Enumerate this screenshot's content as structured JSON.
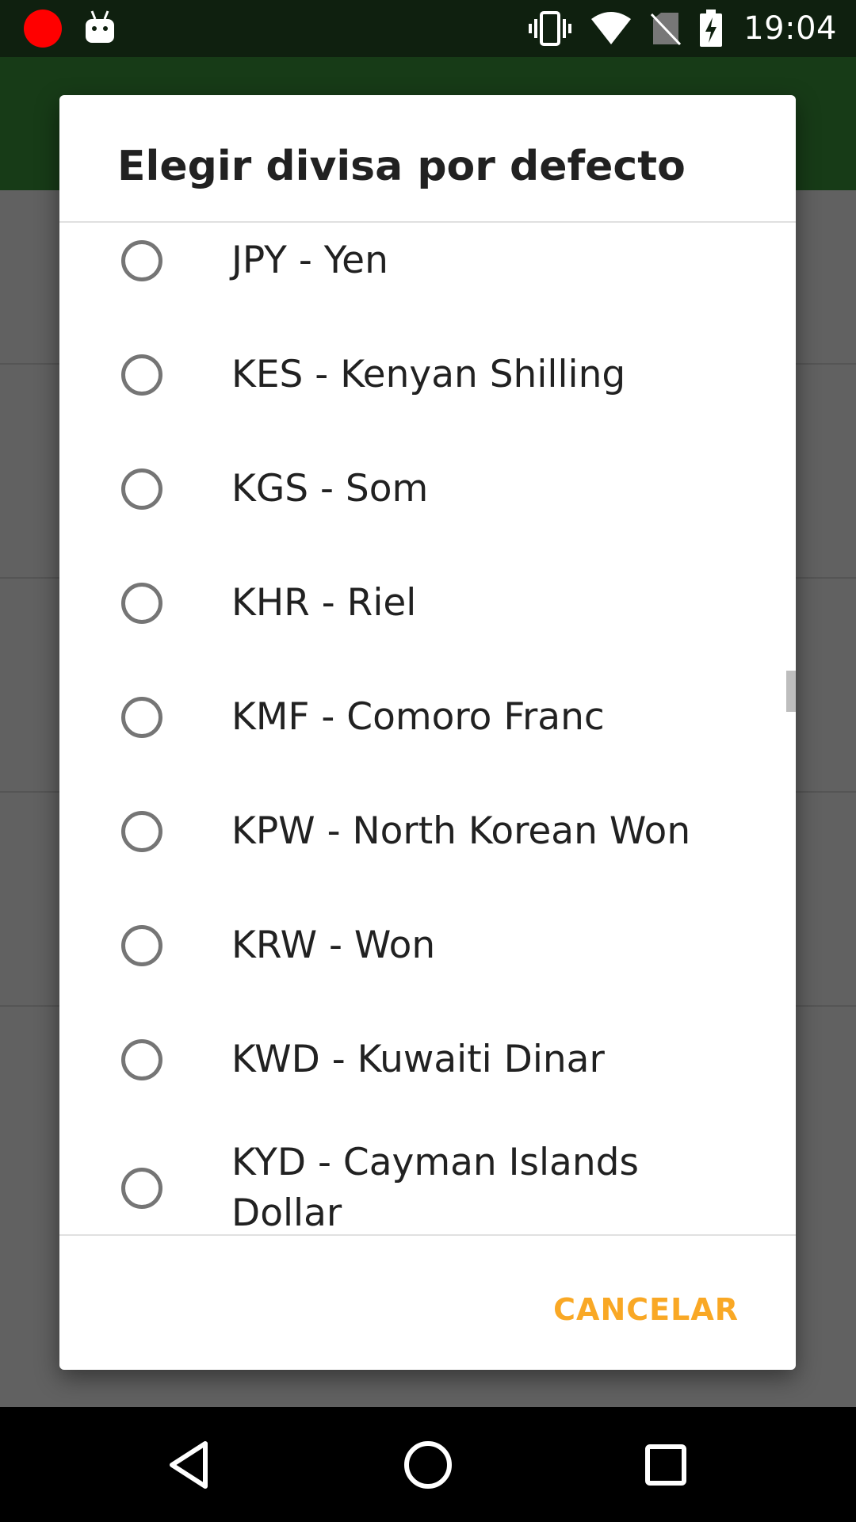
{
  "status_bar": {
    "time": "19:04",
    "icons": [
      "record-icon",
      "android-icon",
      "vibrate-icon",
      "wifi-icon",
      "no-sim-icon",
      "battery-charging-icon"
    ]
  },
  "dialog": {
    "title": "Elegir divisa por defecto",
    "options": [
      {
        "label": "JPY - Yen",
        "selected": false
      },
      {
        "label": "KES - Kenyan Shilling",
        "selected": false
      },
      {
        "label": "KGS - Som",
        "selected": false
      },
      {
        "label": "KHR - Riel",
        "selected": false
      },
      {
        "label": "KMF - Comoro Franc",
        "selected": false
      },
      {
        "label": "KPW - North Korean Won",
        "selected": false
      },
      {
        "label": "KRW - Won",
        "selected": false
      },
      {
        "label": "KWD - Kuwaiti Dinar",
        "selected": false
      },
      {
        "label": "KYD - Cayman Islands Dollar",
        "selected": false
      }
    ],
    "cancel_label": "CANCELAR"
  },
  "colors": {
    "status_bar": "#0f200f",
    "app_bar": "#173b17",
    "scrim": "#616161",
    "accent": "#f9a825",
    "radio": "#757575"
  },
  "nav_bar": {
    "icons": [
      "back-icon",
      "home-icon",
      "recents-icon"
    ]
  }
}
